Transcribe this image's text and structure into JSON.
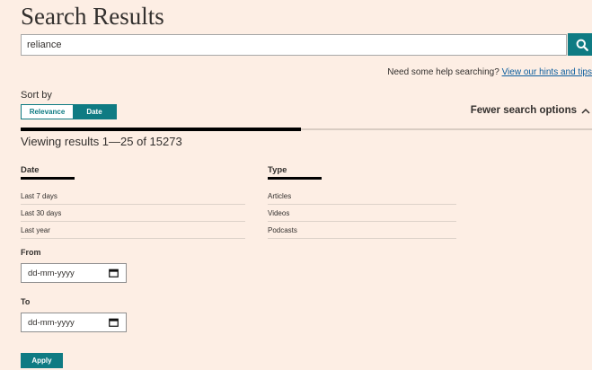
{
  "header": {
    "title": "Search Results"
  },
  "search": {
    "value": "reliance",
    "button_icon": "search-icon"
  },
  "help": {
    "prefix": "Need some help searching?",
    "link_text": "View our hints and tips"
  },
  "sort": {
    "label": "Sort by",
    "options": [
      {
        "label": "Relevance",
        "selected": false
      },
      {
        "label": "Date",
        "selected": true
      }
    ]
  },
  "options_toggle": {
    "label": "Fewer search options",
    "icon": "chevron-up-icon"
  },
  "results": {
    "summary": "Viewing results 1—25 of 15273",
    "progress_fraction": 0.49
  },
  "filters": {
    "date": {
      "heading": "Date",
      "items": [
        "Last 7 days",
        "Last 30 days",
        "Last year"
      ]
    },
    "type": {
      "heading": "Type",
      "items": [
        "Articles",
        "Videos",
        "Podcasts"
      ]
    }
  },
  "date_range": {
    "from": {
      "label": "From",
      "placeholder": "dd-mm-yyyy"
    },
    "to": {
      "label": "To",
      "placeholder": "dd-mm-yyyy"
    },
    "apply_label": "Apply"
  },
  "colors": {
    "accent": "#0f7b83",
    "background": "#fdeee4",
    "link": "#0d5e9e",
    "text": "#33302e"
  }
}
